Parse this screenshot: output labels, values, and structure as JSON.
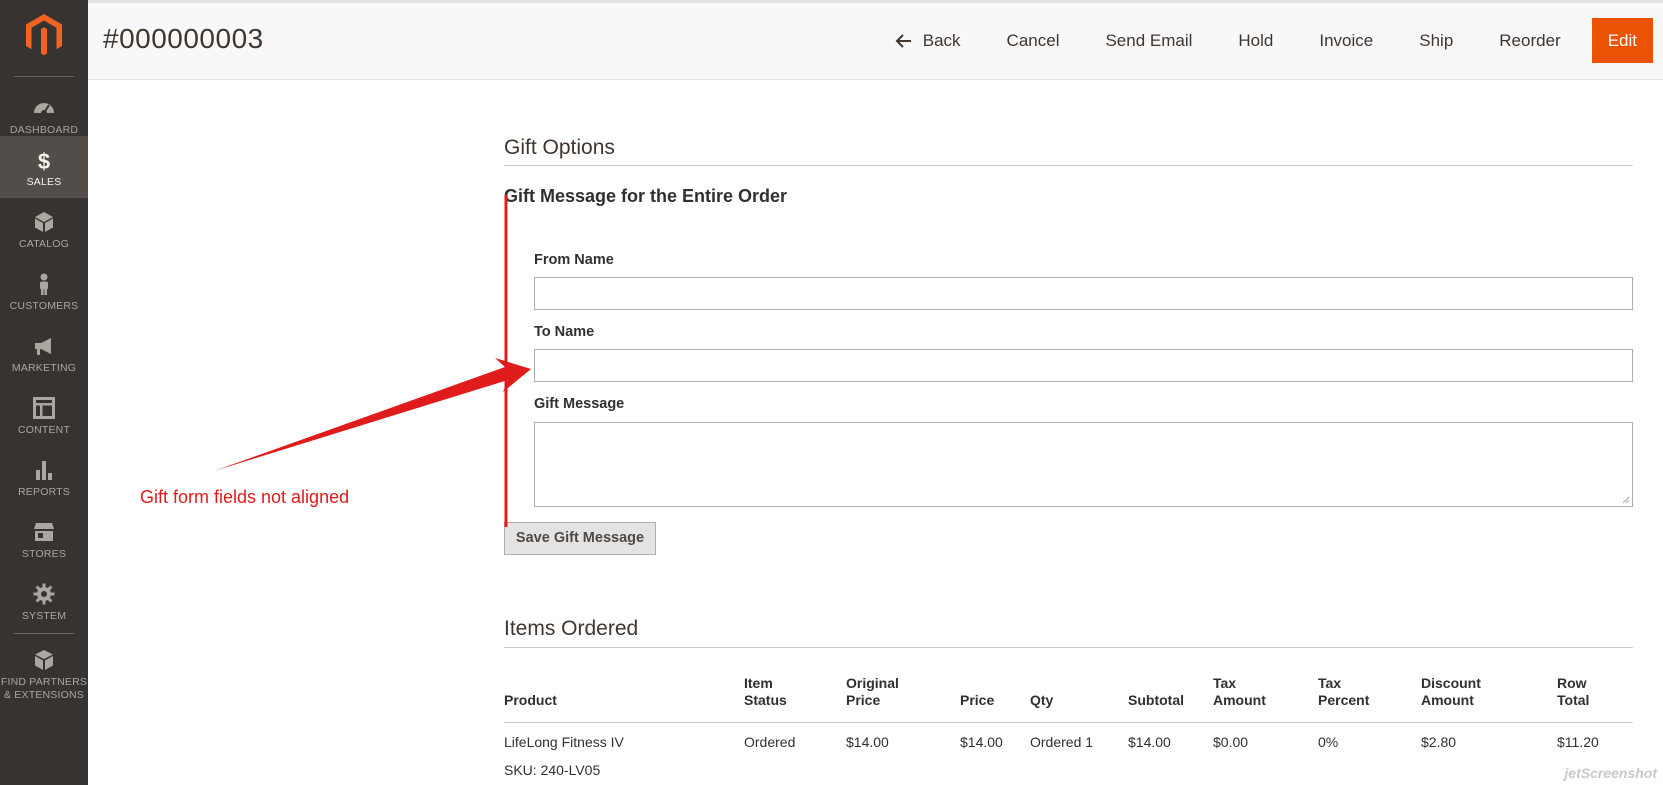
{
  "header": {
    "title": "#000000003",
    "actions": {
      "back": "Back",
      "cancel": "Cancel",
      "send_email": "Send Email",
      "hold": "Hold",
      "invoice": "Invoice",
      "ship": "Ship",
      "reorder": "Reorder",
      "edit": "Edit"
    }
  },
  "sidebar": {
    "items": [
      {
        "label": "DASHBOARD",
        "icon": "dashboard-icon"
      },
      {
        "label": "SALES",
        "icon": "dollar-icon",
        "active": true
      },
      {
        "label": "CATALOG",
        "icon": "box-icon"
      },
      {
        "label": "CUSTOMERS",
        "icon": "person-icon"
      },
      {
        "label": "MARKETING",
        "icon": "megaphone-icon"
      },
      {
        "label": "CONTENT",
        "icon": "layout-icon"
      },
      {
        "label": "REPORTS",
        "icon": "bar-chart-icon"
      },
      {
        "label": "STORES",
        "icon": "storefront-icon"
      },
      {
        "label": "SYSTEM",
        "icon": "gear-icon"
      },
      {
        "label_line1": "FIND PARTNERS",
        "label_line2": "& EXTENSIONS",
        "icon": "cube-icon"
      }
    ]
  },
  "gift_options": {
    "title": "Gift Options",
    "subtitle": "Gift Message for the Entire Order",
    "from_label": "From Name",
    "from_value": "",
    "to_label": "To Name",
    "to_value": "",
    "message_label": "Gift Message",
    "message_value": "",
    "save_label": "Save Gift Message"
  },
  "annotation": {
    "text": "Gift form fields not aligned",
    "color": "#e01b1b"
  },
  "items_ordered": {
    "title": "Items Ordered",
    "columns": [
      {
        "line1": "",
        "line2": "Product"
      },
      {
        "line1": "Item",
        "line2": "Status"
      },
      {
        "line1": "Original",
        "line2": "Price"
      },
      {
        "line1": "",
        "line2": "Price"
      },
      {
        "line1": "",
        "line2": "Qty"
      },
      {
        "line1": "",
        "line2": "Subtotal"
      },
      {
        "line1": "Tax",
        "line2": "Amount"
      },
      {
        "line1": "Tax",
        "line2": "Percent"
      },
      {
        "line1": "Discount",
        "line2": "Amount"
      },
      {
        "line1": "Row",
        "line2": "Total"
      }
    ],
    "rows": [
      {
        "product": "LifeLong Fitness IV",
        "sku": "SKU: 240-LV05",
        "status": "Ordered",
        "original_price": "$14.00",
        "price": "$14.00",
        "qty": "Ordered 1",
        "subtotal": "$14.00",
        "tax_amount": "$0.00",
        "tax_percent": "0%",
        "discount": "$2.80",
        "row_total": "$11.20"
      }
    ]
  },
  "watermark": "jetScreenshot",
  "colors": {
    "accent": "#eb5202",
    "sidebar_bg": "#373330",
    "sidebar_active": "#524d49"
  }
}
